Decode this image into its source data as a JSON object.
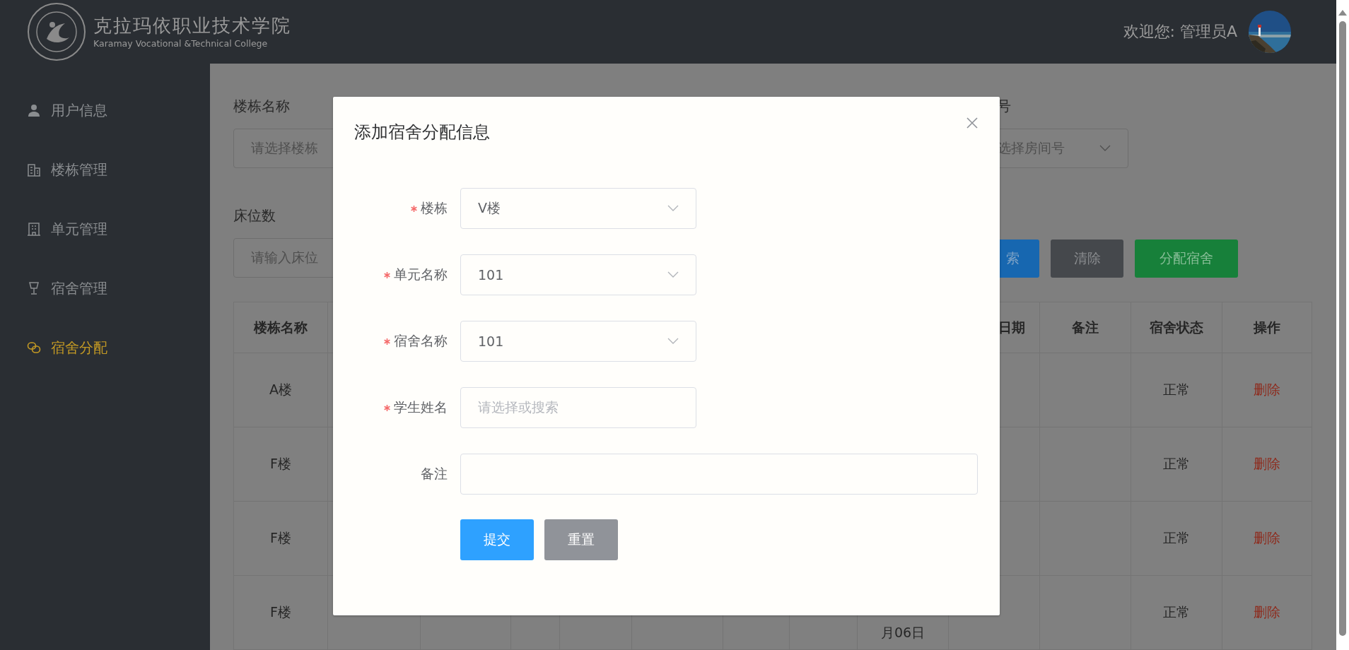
{
  "header": {
    "college_name": "克拉玛依职业技术学院",
    "college_name_en": "Karamay Vocational &Technical College",
    "welcome": "欢迎您: 管理员A"
  },
  "sidebar": {
    "items": [
      {
        "label": "用户信息",
        "selected": false
      },
      {
        "label": "楼栋管理",
        "selected": false
      },
      {
        "label": "单元管理",
        "selected": false
      },
      {
        "label": "宿舍管理",
        "selected": false
      },
      {
        "label": "宿舍分配",
        "selected": true
      }
    ]
  },
  "filters": {
    "building": {
      "label": "楼栋名称",
      "placeholder": "请选择楼栋"
    },
    "room": {
      "label": "号",
      "placeholder": "选择房间号"
    },
    "beds": {
      "label": "床位数",
      "placeholder": "请输入床位"
    }
  },
  "actions": [
    {
      "label": "索",
      "kind": "primary"
    },
    {
      "label": "清除",
      "kind": "neutral"
    },
    {
      "label": "分配宿舍",
      "kind": "success"
    }
  ],
  "table": {
    "columns": {
      "col_1": "楼栋名称",
      "col_10": "日期",
      "col_11": "备注",
      "col_12": "宿舍状态",
      "col_13": "操作"
    },
    "rows": [
      {
        "col_1": "A楼",
        "col_12": "正常",
        "col_13": "删除"
      },
      {
        "col_1": "F楼",
        "col_12": "正常",
        "col_13": "删除"
      },
      {
        "col_1": "F楼",
        "col_12": "正常",
        "col_13": "删除"
      },
      {
        "col_1": "F楼",
        "col_9": "月06日",
        "col_12": "正常",
        "col_13": "删除"
      }
    ]
  },
  "dialog": {
    "title": "添加宿舍分配信息",
    "fields": [
      {
        "label": "楼栋",
        "required": true,
        "kind": "select",
        "value": "V楼"
      },
      {
        "label": "单元名称",
        "required": true,
        "kind": "select",
        "value": "101"
      },
      {
        "label": "宿舍名称",
        "required": true,
        "kind": "select",
        "value": "101"
      },
      {
        "label": "学生姓名",
        "required": true,
        "kind": "input",
        "placeholder": "请选择或搜索"
      },
      {
        "label": "备注",
        "required": false,
        "kind": "wide"
      }
    ],
    "buttons": [
      {
        "label": "提交",
        "kind": "primary"
      },
      {
        "label": "重置",
        "kind": "neutral"
      }
    ]
  }
}
